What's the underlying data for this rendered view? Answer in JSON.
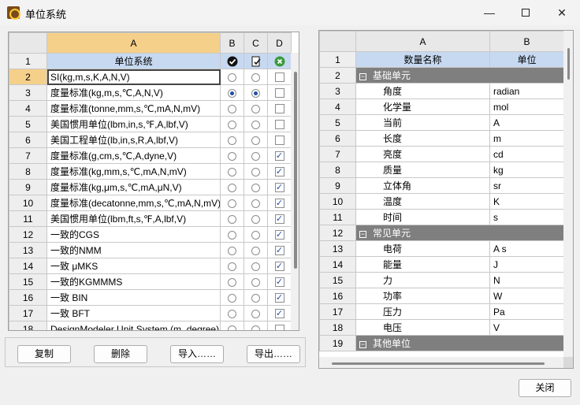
{
  "window": {
    "title": "单位系统"
  },
  "left_table": {
    "columns": [
      "A",
      "B",
      "C",
      "D"
    ],
    "rows": [
      {
        "n": "1",
        "text": "单位系统",
        "header": true
      },
      {
        "n": "2",
        "text": "SI(kg,m,s,K,A,N,V)",
        "b": false,
        "c": false,
        "d": false,
        "selected": true
      },
      {
        "n": "3",
        "text": "度量标准(kg,m,s,℃,A,N,V)",
        "b": true,
        "c": true,
        "d": false
      },
      {
        "n": "4",
        "text": "度量标准(tonne,mm,s,℃,mA,N,mV)",
        "b": false,
        "c": false,
        "d": false
      },
      {
        "n": "5",
        "text": "美国惯用单位(lbm,in,s,℉,A,lbf,V)",
        "b": false,
        "c": false,
        "d": false
      },
      {
        "n": "6",
        "text": "美国工程单位(lb,in,s,R,A,lbf,V)",
        "b": false,
        "c": false,
        "d": false
      },
      {
        "n": "7",
        "text": "度量标准(g,cm,s,℃,A,dyne,V)",
        "b": false,
        "c": false,
        "d": true
      },
      {
        "n": "8",
        "text": "度量标准(kg,mm,s,℃,mA,N,mV)",
        "b": false,
        "c": false,
        "d": true
      },
      {
        "n": "9",
        "text": "度量标准(kg,μm,s,℃,mA,μN,V)",
        "b": false,
        "c": false,
        "d": true
      },
      {
        "n": "10",
        "text": "度量标准(decatonne,mm,s,℃,mA,N,mV)",
        "b": false,
        "c": false,
        "d": true
      },
      {
        "n": "11",
        "text": "美国惯用单位(lbm,ft,s,℉,A,lbf,V)",
        "b": false,
        "c": false,
        "d": true
      },
      {
        "n": "12",
        "text": "一致的CGS",
        "b": false,
        "c": false,
        "d": true
      },
      {
        "n": "13",
        "text": "一致的NMM",
        "b": false,
        "c": false,
        "d": true
      },
      {
        "n": "14",
        "text": "一致 μMKS",
        "b": false,
        "c": false,
        "d": true
      },
      {
        "n": "15",
        "text": "一致的KGMMMS",
        "b": false,
        "c": false,
        "d": true
      },
      {
        "n": "16",
        "text": "一致 BIN",
        "b": false,
        "c": false,
        "d": true
      },
      {
        "n": "17",
        "text": "一致 BFT",
        "b": false,
        "c": false,
        "d": true
      },
      {
        "n": "18",
        "text": "DesignModeler Unit System (m, degree)",
        "b": false,
        "c": false,
        "d": false
      }
    ]
  },
  "buttons": {
    "copy": "复制",
    "delete": "删除",
    "import": "导入……",
    "export": "导出……",
    "close": "关闭"
  },
  "right_table": {
    "columns": [
      "A",
      "B"
    ],
    "rows": [
      {
        "n": "1",
        "a": "数量名称",
        "b": "单位",
        "header": true
      },
      {
        "n": "2",
        "a": "基础单元",
        "group": true
      },
      {
        "n": "3",
        "a": "角度",
        "b": "radian"
      },
      {
        "n": "4",
        "a": "化学量",
        "b": "mol"
      },
      {
        "n": "5",
        "a": "当前",
        "b": "A"
      },
      {
        "n": "6",
        "a": "长度",
        "b": "m"
      },
      {
        "n": "7",
        "a": "亮度",
        "b": "cd"
      },
      {
        "n": "8",
        "a": "质量",
        "b": "kg"
      },
      {
        "n": "9",
        "a": "立体角",
        "b": "sr"
      },
      {
        "n": "10",
        "a": "温度",
        "b": "K"
      },
      {
        "n": "11",
        "a": "时间",
        "b": "s"
      },
      {
        "n": "12",
        "a": "常见单元",
        "group": true
      },
      {
        "n": "13",
        "a": "电荷",
        "b": "A s"
      },
      {
        "n": "14",
        "a": "能量",
        "b": "J"
      },
      {
        "n": "15",
        "a": "力",
        "b": "N"
      },
      {
        "n": "16",
        "a": "功率",
        "b": "W"
      },
      {
        "n": "17",
        "a": "压力",
        "b": "Pa"
      },
      {
        "n": "18",
        "a": "电压",
        "b": "V"
      },
      {
        "n": "19",
        "a": "其他单位",
        "group": true
      }
    ]
  }
}
